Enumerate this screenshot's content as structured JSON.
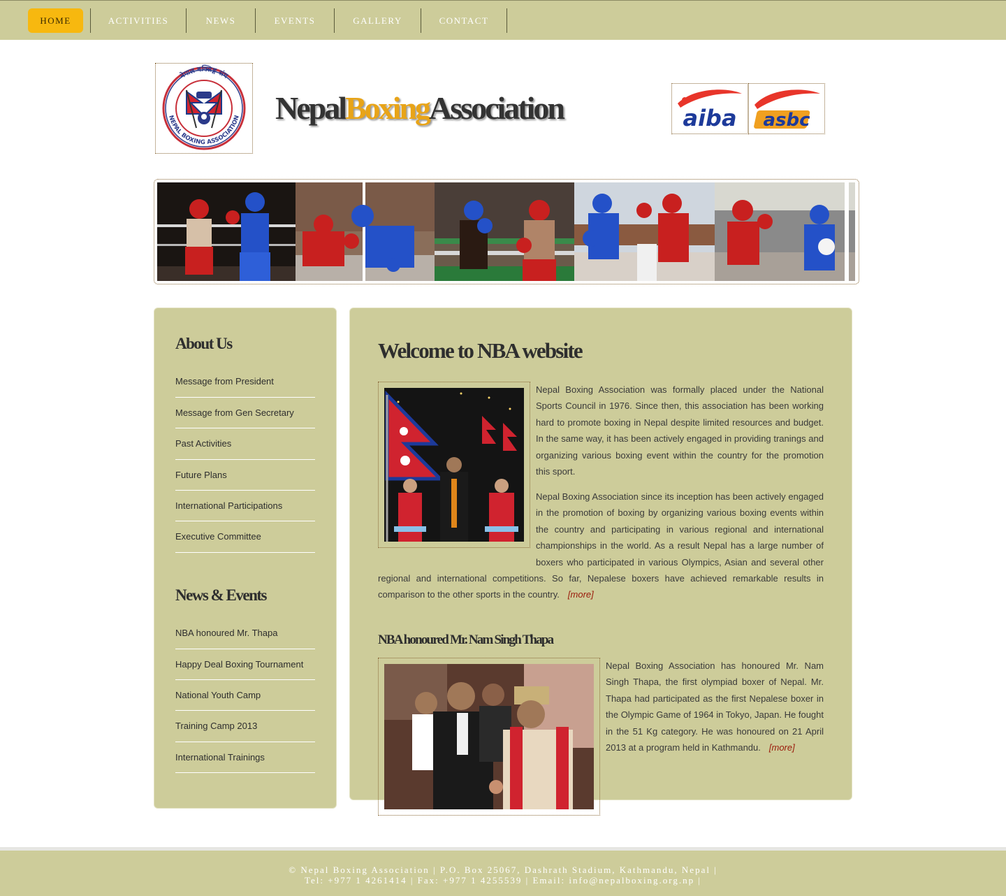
{
  "nav": {
    "items": [
      "HOME",
      "ACTIVITIES",
      "NEWS",
      "EVENTS",
      "GALLERY",
      "CONTACT"
    ],
    "active": "HOME"
  },
  "header": {
    "title_part1": "Nepal",
    "title_part2": "Boxing",
    "title_part3": "Association",
    "logo_ring_text": "NEPAL BOXING ASSOCIATION",
    "logo_top_text": "नेपाल बक्सिङ्ग संघ",
    "partner1_text": "aiba",
    "partner2_text": "asbc"
  },
  "sidebar": {
    "about_heading": "About Us",
    "about_links": [
      "Message from President",
      "Message from Gen Secretary",
      "Past Activities",
      "Future Plans",
      "International Participations",
      "Executive Committee"
    ],
    "news_heading": "News & Events",
    "news_links": [
      "NBA honoured Mr. Thapa",
      "Happy Deal Boxing Tournament",
      "National Youth Camp",
      "Training Camp 2013",
      "International Trainings"
    ]
  },
  "main": {
    "welcome_title": "Welcome to NBA website",
    "welcome_p1": "Nepal Boxing Association was formally placed under the National Sports Council in 1976. Since then, this association has been working hard to promote boxing in Nepal despite limited resources and budget. In the same way, it has been actively engaged in providing tranings and organizing various boxing event within the country for the promotion this sport.",
    "welcome_p2": "Nepal Boxing Association since its inception has been actively engaged in the promotion of boxing by organizing various boxing events within the country and participating in various regional and international championships in the world. As a result Nepal has a large number of boxers who participated in various Olympics, Asian and several other regional and international competitions. So far, Nepalese boxers have achieved remarkable results in comparison to the other sports in the country.",
    "more_label": "[more]",
    "news_title": "NBA honoured Mr. Nam Singh Thapa",
    "news_p": "Nepal Boxing Association has honoured Mr. Nam Singh Thapa, the first olympiad boxer of Nepal. Mr. Thapa had participated as the first Nepalese boxer in the Olympic Game of 1964 in Tokyo, Japan. He fought in the 51 Kg category. He was honoured on 21 April 2013 at a program held in Kathmandu."
  },
  "footer": {
    "line1": "© Nepal Boxing Association | P.O. Box 25067, Dashrath Stadium, Kathmandu, Nepal |",
    "line2": "Tel: +977 1 4261414 | Fax: +977 1 4255539 | Email: info@nepalboxing.org.np |"
  },
  "colors": {
    "olive": "#cdcc9a",
    "accent_gold": "#f7b80f",
    "title_gold": "#e8a418",
    "link_red": "#9a1a0a"
  }
}
